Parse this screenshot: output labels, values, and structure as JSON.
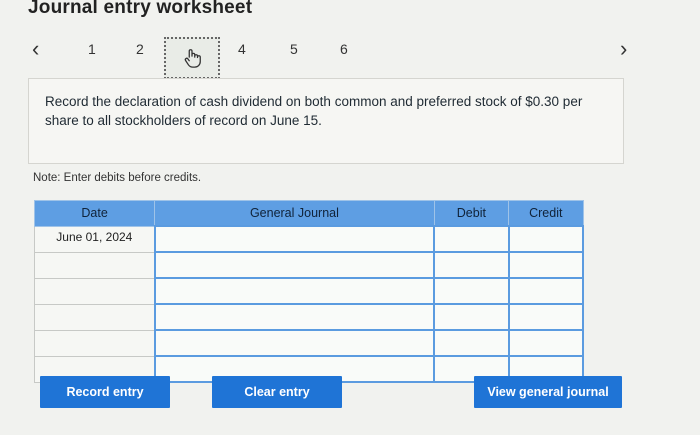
{
  "page": {
    "title": "Journal entry worksheet"
  },
  "nav": {
    "prev_icon": "chevron-left-icon",
    "next_icon": "chevron-right-icon",
    "pages": [
      "1",
      "2",
      "3",
      "4",
      "5",
      "6"
    ],
    "current_page_icon": "hand-pointer-icon"
  },
  "prompt": {
    "text": "Record the declaration of cash dividend on both common and preferred stock of $0.30 per share to all stockholders of record on June 15."
  },
  "note": "Note: Enter debits before credits.",
  "journal": {
    "headers": {
      "date": "Date",
      "general_journal": "General Journal",
      "debit": "Debit",
      "credit": "Credit"
    },
    "rows": [
      {
        "date": "June 01, 2024",
        "account": "",
        "debit": "",
        "credit": ""
      },
      {
        "date": "",
        "account": "",
        "debit": "",
        "credit": ""
      },
      {
        "date": "",
        "account": "",
        "debit": "",
        "credit": ""
      },
      {
        "date": "",
        "account": "",
        "debit": "",
        "credit": ""
      },
      {
        "date": "",
        "account": "",
        "debit": "",
        "credit": ""
      },
      {
        "date": "",
        "account": "",
        "debit": "",
        "credit": ""
      }
    ]
  },
  "buttons": {
    "record": "Record entry",
    "clear": "Clear entry",
    "view": "View general journal"
  },
  "colors": {
    "accent": "#1f74d6",
    "header": "#5e9ee3"
  }
}
